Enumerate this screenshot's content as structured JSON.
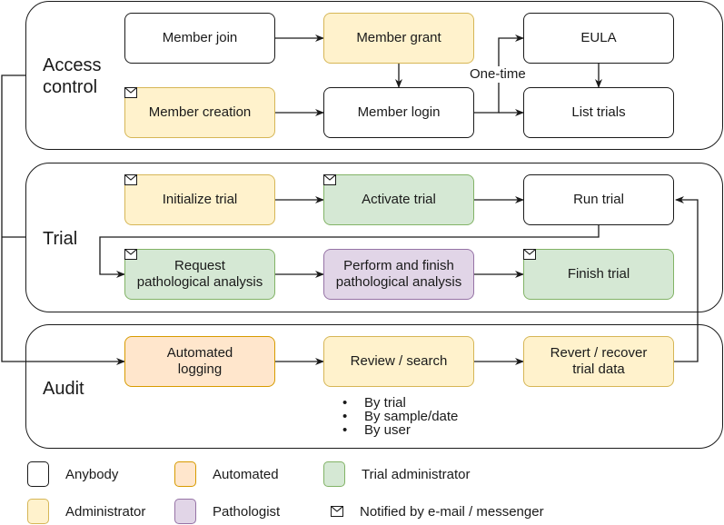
{
  "groups": {
    "access_control": {
      "label": "Access\ncontrol"
    },
    "trial": {
      "label": "Trial"
    },
    "audit": {
      "label": "Audit"
    }
  },
  "nodes": {
    "member_join": {
      "label": "Member join",
      "role": "anybody",
      "notified": false
    },
    "member_grant": {
      "label": "Member grant",
      "role": "administrator",
      "notified": false
    },
    "eula": {
      "label": "EULA",
      "role": "anybody",
      "notified": false
    },
    "member_creation": {
      "label": "Member creation",
      "role": "administrator",
      "notified": true
    },
    "member_login": {
      "label": "Member login",
      "role": "anybody",
      "notified": false
    },
    "list_trials": {
      "label": "List trials",
      "role": "anybody",
      "notified": false
    },
    "initialize_trial": {
      "label": "Initialize trial",
      "role": "administrator",
      "notified": true
    },
    "activate_trial": {
      "label": "Activate trial",
      "role": "trial administrator",
      "notified": true
    },
    "run_trial": {
      "label": "Run trial",
      "role": "anybody",
      "notified": false
    },
    "request_analysis": {
      "label": "Request\npathological analysis",
      "role": "trial administrator",
      "notified": true
    },
    "perform_analysis": {
      "label": "Perform and finish\npathological analysis",
      "role": "pathologist",
      "notified": false
    },
    "finish_trial": {
      "label": "Finish trial",
      "role": "trial administrator",
      "notified": true
    },
    "automated_logging": {
      "label": "Automated\nlogging",
      "role": "automated",
      "notified": false
    },
    "review_search": {
      "label": "Review / search",
      "role": "administrator",
      "notified": false
    },
    "revert_recover": {
      "label": "Revert / recover\ntrial data",
      "role": "administrator",
      "notified": false
    }
  },
  "edge_labels": {
    "one_time": "One-time"
  },
  "edges": [
    [
      "member_join",
      "member_grant"
    ],
    [
      "member_grant",
      "member_login"
    ],
    [
      "member_creation",
      "member_login"
    ],
    [
      "member_login",
      "eula",
      "One-time"
    ],
    [
      "member_login",
      "list_trials"
    ],
    [
      "eula",
      "list_trials"
    ],
    [
      "initialize_trial",
      "activate_trial"
    ],
    [
      "activate_trial",
      "run_trial"
    ],
    [
      "run_trial",
      "request_analysis"
    ],
    [
      "request_analysis",
      "perform_analysis"
    ],
    [
      "perform_analysis",
      "finish_trial"
    ],
    [
      "access_control",
      "automated_logging"
    ],
    [
      "trial",
      "automated_logging"
    ],
    [
      "automated_logging",
      "review_search"
    ],
    [
      "review_search",
      "revert_recover"
    ],
    [
      "revert_recover",
      "run_trial"
    ]
  ],
  "review_options": [
    "By trial",
    "By sample/date",
    "By user"
  ],
  "legend": {
    "anybody": {
      "label": "Anybody",
      "color": "#ffffff",
      "border": "#1a1a1a"
    },
    "automated": {
      "label": "Automated",
      "color": "#ffe6cc",
      "border": "#d79b00"
    },
    "trial_administrator": {
      "label": "Trial administrator",
      "color": "#d5e8d4",
      "border": "#82b366"
    },
    "administrator": {
      "label": "Administrator",
      "color": "#fff2cc",
      "border": "#d6b656"
    },
    "pathologist": {
      "label": "Pathologist",
      "color": "#e1d5e7",
      "border": "#9673a6"
    },
    "notified": {
      "label": "Notified by e-mail / messenger",
      "icon": "envelope-icon"
    }
  }
}
